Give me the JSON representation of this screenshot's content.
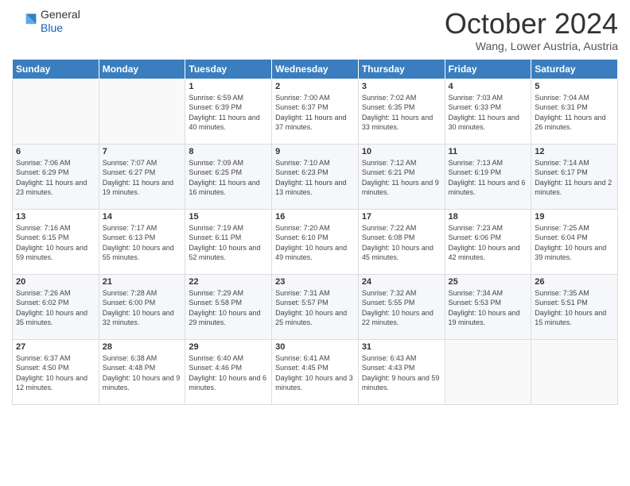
{
  "header": {
    "logo_general": "General",
    "logo_blue": "Blue",
    "title": "October 2024",
    "location": "Wang, Lower Austria, Austria"
  },
  "days_of_week": [
    "Sunday",
    "Monday",
    "Tuesday",
    "Wednesday",
    "Thursday",
    "Friday",
    "Saturday"
  ],
  "weeks": [
    [
      {
        "day": "",
        "info": ""
      },
      {
        "day": "",
        "info": ""
      },
      {
        "day": "1",
        "info": "Sunrise: 6:59 AM\nSunset: 6:39 PM\nDaylight: 11 hours and 40 minutes."
      },
      {
        "day": "2",
        "info": "Sunrise: 7:00 AM\nSunset: 6:37 PM\nDaylight: 11 hours and 37 minutes."
      },
      {
        "day": "3",
        "info": "Sunrise: 7:02 AM\nSunset: 6:35 PM\nDaylight: 11 hours and 33 minutes."
      },
      {
        "day": "4",
        "info": "Sunrise: 7:03 AM\nSunset: 6:33 PM\nDaylight: 11 hours and 30 minutes."
      },
      {
        "day": "5",
        "info": "Sunrise: 7:04 AM\nSunset: 6:31 PM\nDaylight: 11 hours and 26 minutes."
      }
    ],
    [
      {
        "day": "6",
        "info": "Sunrise: 7:06 AM\nSunset: 6:29 PM\nDaylight: 11 hours and 23 minutes."
      },
      {
        "day": "7",
        "info": "Sunrise: 7:07 AM\nSunset: 6:27 PM\nDaylight: 11 hours and 19 minutes."
      },
      {
        "day": "8",
        "info": "Sunrise: 7:09 AM\nSunset: 6:25 PM\nDaylight: 11 hours and 16 minutes."
      },
      {
        "day": "9",
        "info": "Sunrise: 7:10 AM\nSunset: 6:23 PM\nDaylight: 11 hours and 13 minutes."
      },
      {
        "day": "10",
        "info": "Sunrise: 7:12 AM\nSunset: 6:21 PM\nDaylight: 11 hours and 9 minutes."
      },
      {
        "day": "11",
        "info": "Sunrise: 7:13 AM\nSunset: 6:19 PM\nDaylight: 11 hours and 6 minutes."
      },
      {
        "day": "12",
        "info": "Sunrise: 7:14 AM\nSunset: 6:17 PM\nDaylight: 11 hours and 2 minutes."
      }
    ],
    [
      {
        "day": "13",
        "info": "Sunrise: 7:16 AM\nSunset: 6:15 PM\nDaylight: 10 hours and 59 minutes."
      },
      {
        "day": "14",
        "info": "Sunrise: 7:17 AM\nSunset: 6:13 PM\nDaylight: 10 hours and 55 minutes."
      },
      {
        "day": "15",
        "info": "Sunrise: 7:19 AM\nSunset: 6:11 PM\nDaylight: 10 hours and 52 minutes."
      },
      {
        "day": "16",
        "info": "Sunrise: 7:20 AM\nSunset: 6:10 PM\nDaylight: 10 hours and 49 minutes."
      },
      {
        "day": "17",
        "info": "Sunrise: 7:22 AM\nSunset: 6:08 PM\nDaylight: 10 hours and 45 minutes."
      },
      {
        "day": "18",
        "info": "Sunrise: 7:23 AM\nSunset: 6:06 PM\nDaylight: 10 hours and 42 minutes."
      },
      {
        "day": "19",
        "info": "Sunrise: 7:25 AM\nSunset: 6:04 PM\nDaylight: 10 hours and 39 minutes."
      }
    ],
    [
      {
        "day": "20",
        "info": "Sunrise: 7:26 AM\nSunset: 6:02 PM\nDaylight: 10 hours and 35 minutes."
      },
      {
        "day": "21",
        "info": "Sunrise: 7:28 AM\nSunset: 6:00 PM\nDaylight: 10 hours and 32 minutes."
      },
      {
        "day": "22",
        "info": "Sunrise: 7:29 AM\nSunset: 5:58 PM\nDaylight: 10 hours and 29 minutes."
      },
      {
        "day": "23",
        "info": "Sunrise: 7:31 AM\nSunset: 5:57 PM\nDaylight: 10 hours and 25 minutes."
      },
      {
        "day": "24",
        "info": "Sunrise: 7:32 AM\nSunset: 5:55 PM\nDaylight: 10 hours and 22 minutes."
      },
      {
        "day": "25",
        "info": "Sunrise: 7:34 AM\nSunset: 5:53 PM\nDaylight: 10 hours and 19 minutes."
      },
      {
        "day": "26",
        "info": "Sunrise: 7:35 AM\nSunset: 5:51 PM\nDaylight: 10 hours and 15 minutes."
      }
    ],
    [
      {
        "day": "27",
        "info": "Sunrise: 6:37 AM\nSunset: 4:50 PM\nDaylight: 10 hours and 12 minutes."
      },
      {
        "day": "28",
        "info": "Sunrise: 6:38 AM\nSunset: 4:48 PM\nDaylight: 10 hours and 9 minutes."
      },
      {
        "day": "29",
        "info": "Sunrise: 6:40 AM\nSunset: 4:46 PM\nDaylight: 10 hours and 6 minutes."
      },
      {
        "day": "30",
        "info": "Sunrise: 6:41 AM\nSunset: 4:45 PM\nDaylight: 10 hours and 3 minutes."
      },
      {
        "day": "31",
        "info": "Sunrise: 6:43 AM\nSunset: 4:43 PM\nDaylight: 9 hours and 59 minutes."
      },
      {
        "day": "",
        "info": ""
      },
      {
        "day": "",
        "info": ""
      }
    ]
  ]
}
